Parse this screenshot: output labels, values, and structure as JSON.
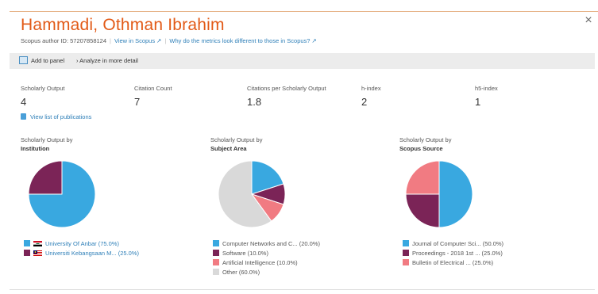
{
  "header": {
    "name": "Hammadi, Othman Ibrahim",
    "author_id_label": "Scopus author ID: 57207858124",
    "view_scopus_link": "View in Scopus ↗",
    "metrics_diff_link": "Why do the metrics look different to those in Scopus? ↗",
    "close_glyph": "×"
  },
  "toolbar": {
    "add_to_panel": "Add to panel",
    "analyze": "› Analyze in more detail"
  },
  "metrics": [
    {
      "label": "Scholarly Output",
      "value": "4"
    },
    {
      "label": "Citation Count",
      "value": "7"
    },
    {
      "label": "Citations per Scholarly Output",
      "value": "1.8"
    },
    {
      "label": "h-index",
      "value": "2"
    },
    {
      "label": "h5-index",
      "value": "1"
    }
  ],
  "view_list_label": "View list of publications",
  "colors": {
    "blue": "#39a8e0",
    "purple": "#7b2457",
    "pink": "#f17b82",
    "grey": "#d9d9d9",
    "title_orange": "#e25a17",
    "link_blue": "#2e7fb8"
  },
  "chart_data": [
    {
      "type": "pie",
      "title_line1": "Scholarly Output by",
      "title_line2": "Institution",
      "categories": [
        "University Of Anbar",
        "Universiti Kebangsaan M..."
      ],
      "values": [
        75.0,
        25.0
      ],
      "legend_labels": [
        "University Of Anbar (75.0%)",
        "Universiti Kebangsaan M... (25.0%)"
      ],
      "colors": [
        "#39a8e0",
        "#7b2457"
      ]
    },
    {
      "type": "pie",
      "title_line1": "Scholarly Output by",
      "title_line2": "Subject Area",
      "categories": [
        "Computer Networks and C...",
        "Software",
        "Artificial Intelligence",
        "Other"
      ],
      "values": [
        20.0,
        10.0,
        10.0,
        60.0
      ],
      "legend_labels": [
        "Computer Networks and C... (20.0%)",
        "Software (10.0%)",
        "Artificial Intelligence (10.0%)",
        "Other (60.0%)"
      ],
      "colors": [
        "#39a8e0",
        "#7b2457",
        "#f17b82",
        "#d9d9d9"
      ]
    },
    {
      "type": "pie",
      "title_line1": "Scholarly Output by",
      "title_line2": "Scopus Source",
      "categories": [
        "Journal of Computer Sci...",
        "Proceedings - 2018 1st ...",
        "Bulletin of Electrical ..."
      ],
      "values": [
        50.0,
        25.0,
        25.0
      ],
      "legend_labels": [
        "Journal of Computer Sci... (50.0%)",
        "Proceedings - 2018 1st ... (25.0%)",
        "Bulletin of Electrical ... (25.0%)"
      ],
      "colors": [
        "#39a8e0",
        "#7b2457",
        "#f17b82"
      ]
    }
  ]
}
